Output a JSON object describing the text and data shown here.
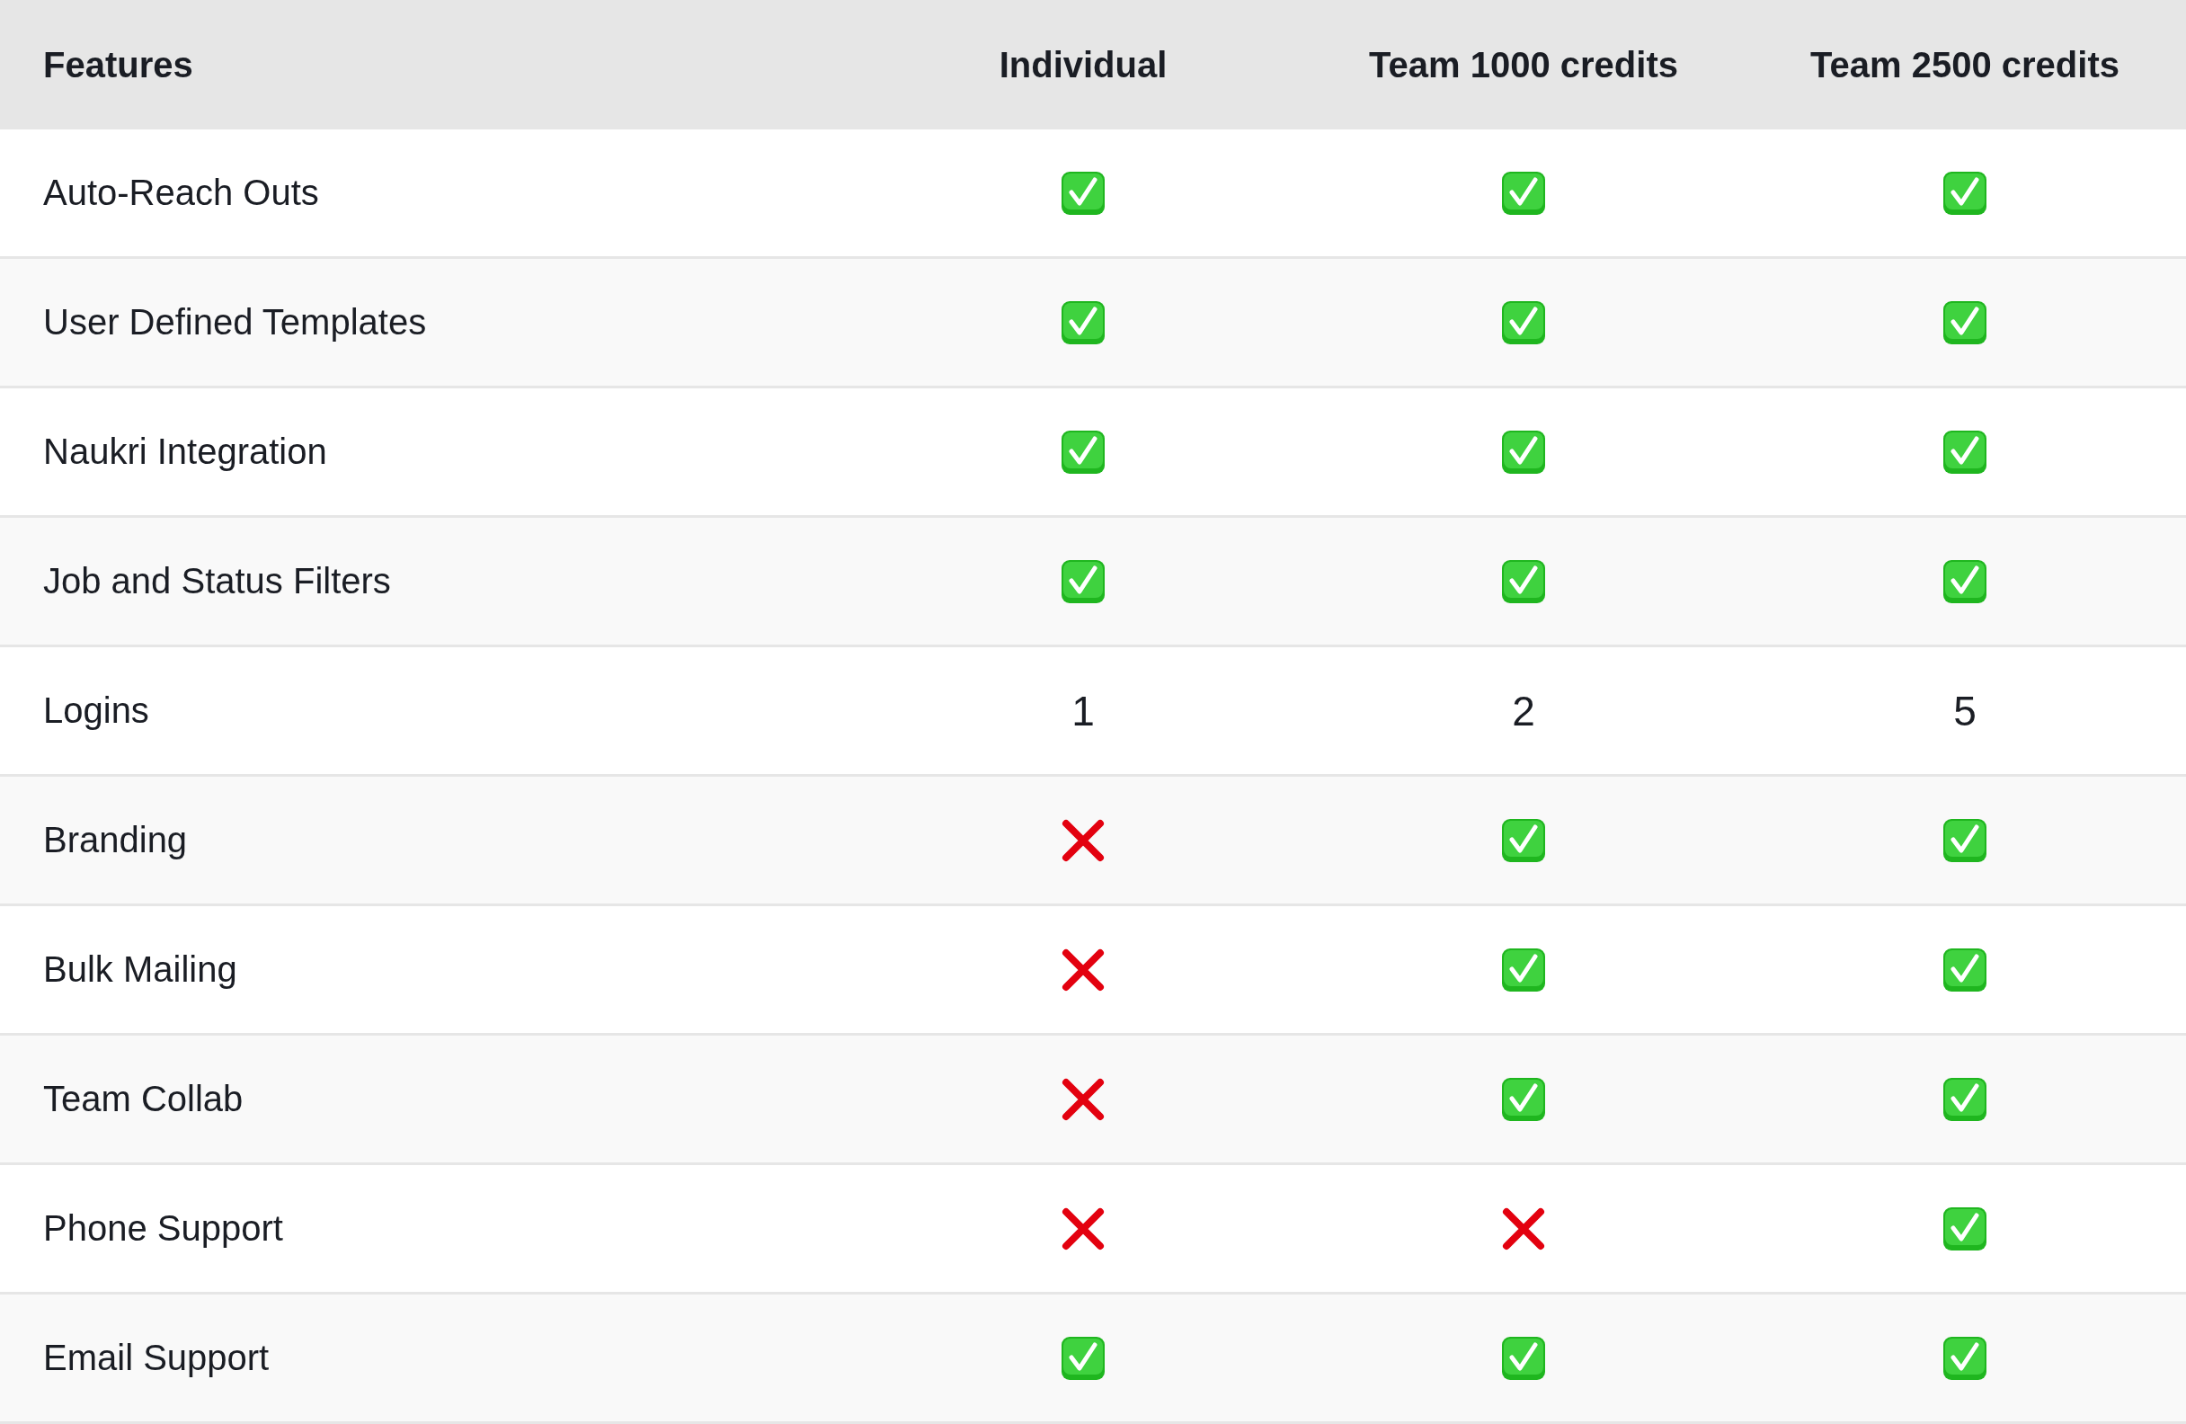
{
  "table": {
    "columns": [
      "Features",
      "Individual",
      "Team 1000 credits",
      "Team 2500 credits"
    ],
    "rows": [
      {
        "cells": [
          {
            "kind": "text",
            "text": "Auto-Reach Outs"
          },
          {
            "kind": "check"
          },
          {
            "kind": "check"
          },
          {
            "kind": "check"
          }
        ]
      },
      {
        "cells": [
          {
            "kind": "text",
            "text": "User Defined Templates"
          },
          {
            "kind": "check"
          },
          {
            "kind": "check"
          },
          {
            "kind": "check"
          }
        ]
      },
      {
        "cells": [
          {
            "kind": "text",
            "text": "Naukri Integration"
          },
          {
            "kind": "check"
          },
          {
            "kind": "check"
          },
          {
            "kind": "check"
          }
        ]
      },
      {
        "cells": [
          {
            "kind": "text",
            "text": "Job and Status Filters"
          },
          {
            "kind": "check"
          },
          {
            "kind": "check"
          },
          {
            "kind": "check"
          }
        ]
      },
      {
        "cells": [
          {
            "kind": "text",
            "text": "Logins"
          },
          {
            "kind": "text",
            "text": "1"
          },
          {
            "kind": "text",
            "text": "2"
          },
          {
            "kind": "text",
            "text": "5"
          }
        ]
      },
      {
        "cells": [
          {
            "kind": "text",
            "text": "Branding"
          },
          {
            "kind": "cross"
          },
          {
            "kind": "check"
          },
          {
            "kind": "check"
          }
        ]
      },
      {
        "cells": [
          {
            "kind": "text",
            "text": "Bulk Mailing"
          },
          {
            "kind": "cross"
          },
          {
            "kind": "check"
          },
          {
            "kind": "check"
          }
        ]
      },
      {
        "cells": [
          {
            "kind": "text",
            "text": "Team Collab"
          },
          {
            "kind": "cross"
          },
          {
            "kind": "check"
          },
          {
            "kind": "check"
          }
        ]
      },
      {
        "cells": [
          {
            "kind": "text",
            "text": "Phone Support"
          },
          {
            "kind": "cross"
          },
          {
            "kind": "cross"
          },
          {
            "kind": "check"
          }
        ]
      },
      {
        "cells": [
          {
            "kind": "text",
            "text": "Email Support"
          },
          {
            "kind": "check"
          },
          {
            "kind": "check"
          },
          {
            "kind": "check"
          }
        ]
      }
    ]
  }
}
